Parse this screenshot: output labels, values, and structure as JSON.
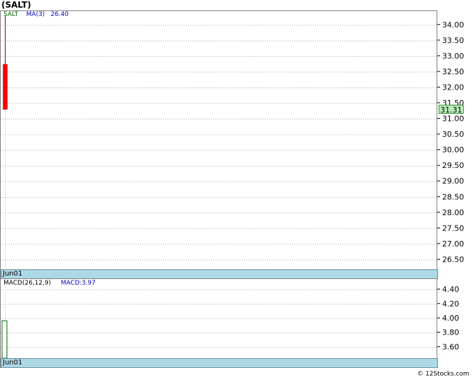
{
  "title": "(SALT)",
  "price_panel": {
    "legend_symbol": "SALT",
    "legend_ma": "MA(3)",
    "legend_ma_value": "26.40",
    "last_price": "31.31",
    "date_label": "Jun01",
    "y_ticks": [
      "34.00",
      "33.50",
      "33.00",
      "32.50",
      "32.00",
      "31.50",
      "31.00",
      "30.50",
      "30.00",
      "29.50",
      "29.00",
      "28.50",
      "28.00",
      "27.50",
      "27.00",
      "26.50"
    ]
  },
  "macd_panel": {
    "legend_label": "MACD(26,12,9)",
    "legend_value": "MACD:3.97",
    "date_label": "Jun01",
    "y_ticks": [
      "4.40",
      "4.20",
      "4.00",
      "3.80",
      "3.60"
    ]
  },
  "copyright": "© 12Stocks.com",
  "colors": {
    "bear_candle": "#ff0000",
    "wick": "#800000",
    "macd_bar_border": "#006400",
    "grid": "#aaaaaa",
    "date_band": "#add8e6",
    "last_price_bg": "#b9f0b9"
  },
  "chart_data": [
    {
      "type": "candlestick",
      "title": "(SALT)",
      "ylim": [
        26.2,
        34.45
      ],
      "grid": true,
      "categories": [
        "Jun01"
      ],
      "series": [
        {
          "name": "SALT",
          "open": [
            32.75
          ],
          "high": [
            34.3
          ],
          "low": [
            31.31
          ],
          "close": [
            31.31
          ]
        }
      ],
      "ma": {
        "name": "MA(3)",
        "value": 26.4
      }
    },
    {
      "type": "bar",
      "title": "MACD(26,12,9)",
      "ylim": [
        3.45,
        4.55
      ],
      "grid": true,
      "categories": [
        "Jun01"
      ],
      "series": [
        {
          "name": "MACD",
          "values": [
            3.97
          ]
        }
      ]
    }
  ]
}
